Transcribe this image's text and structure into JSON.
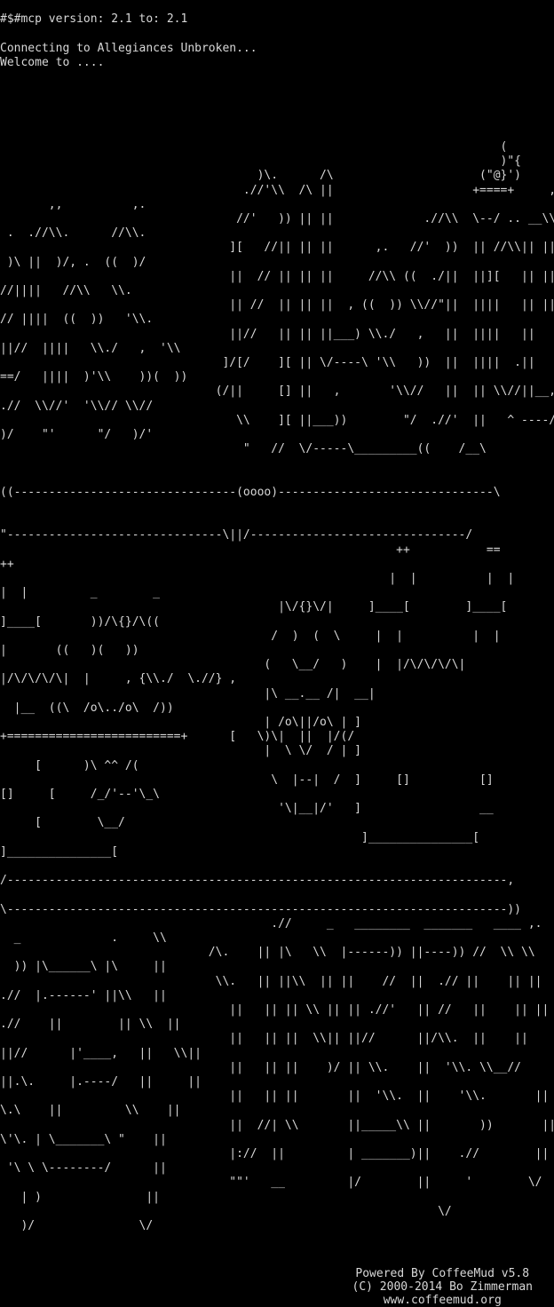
{
  "terminal": {
    "mcp_line": "#$#mcp version: 2.1 to: 2.1",
    "connecting": "Connecting to Allegiances Unbroken...",
    "welcome": "Welcome to ....",
    "art": [
      "                                                                        (",
      "                                                                        )\"{",
      "                                     )\\.      /\\                     (\"@}')",
      "                                   .//'\\\\  /\\ ||                    +====+     ,",
      "       ,,          ,.",
      "                                  //'   )) || ||             .//\\\\  \\--/ .. __\\\\.",
      " .  .//\\\\.      //\\\\.",
      "                                 ][   //|| || ||      ,.   //'  ))  || //\\\\|| ||",
      " )\\ ||  )/, .  ((  )/",
      "                                 ||  // || || ||     //\\\\ ((  ./||  ||][   || ||",
      "//||||   //\\\\   \\\\.",
      "                                 || //  || || ||  , ((  )) \\\\//\"||  ||||   || ||",
      "// ||||  ((  ))   '\\\\.",
      "                                 ||//   || || ||___) \\\\./   ,   ||  ||||   ||",
      "||//  ||||   \\\\./   ,  '\\\\",
      "                                ]/[/    ][ || \\/----\\ '\\\\   ))  ||  ||||  .||",
      "==/   ||||  )'\\\\    ))(  ))",
      "                               (/||     [] ||   ,       '\\\\//   ||  || \\\\//||__,",
      ".//  \\\\//'  '\\\\// \\\\//",
      "                                  \\\\    ][ ||___))        \"/  .//'  ||   ^ ----/",
      ")/    \"'      \"/   )/'",
      "                                   \"   //  \\/-----\\_________((    /__\\",
      "",
      "",
      "((--------------------------------(oooo)-------------------------------\\",
      "",
      "",
      "\"-------------------------------\\||/-------------------------------/",
      "                                                         ++           ==",
      "++",
      "                                                        |  |          |  |",
      "|  |         _        _",
      "                                        |\\/{}\\/|     ]____[        ]____[",
      "]____[       ))/\\{}/\\((",
      "                                       /  )  (  \\     |  |          |  |         |",
      "|       ((   )(   ))",
      "                                      (   \\__/   )    |  |/\\/\\/\\/\\|",
      "|/\\/\\/\\/\\|  |     , {\\\\./  \\.//} ,",
      "                                      |\\ __.__ /|  __|",
      "  |__  ((\\  /o\\../o\\  /))",
      "                                      | /o\\||/o\\ | ]",
      "+=========================+      [   \\)\\|  ||  |/(/",
      "                                      |  \\ \\/  / | ]",
      "     [      )\\ ^^ /(",
      "                                       \\  |--|  /  ]     []          []",
      "[]     [     /_/'--'\\_\\",
      "                                        '\\|__|/'   ]                 __",
      "     [        \\__/",
      "                                                    ]_______________[",
      "]_______________[",
      "",
      "/------------------------------------------------------------------------,",
      "",
      "\\------------------------------------------------------------------------))",
      "                                       .//     _   ________  _______   ____ ,.",
      "  _             .     \\\\",
      "                              /\\.    || |\\   \\\\  |------)) ||----)) //  \\\\ \\\\",
      "  )) |\\______\\ |\\     ||",
      "                               \\\\.   || ||\\\\  || ||    //  ||  .// ||    || ||",
      ".//  |.------' ||\\\\   ||",
      "                                 ||   || || \\\\ || || .//'   || //   ||    || ||",
      ".//    ||        || \\\\  ||",
      "                                 ||   || ||  \\\\|| ||//      ||/\\\\.  ||    ||",
      "||//      |'____,   ||   \\\\||",
      "                                 ||   || ||    )/ || \\\\.    ||  '\\\\. \\\\__//",
      "||.\\.     |.----/   ||     ||",
      "                                 ||   || ||       ||  '\\\\.  ||    '\\\\.       ||",
      "\\.\\    ||         \\\\    ||",
      "                                 ||  //| \\\\       ||_____\\\\ ||       ))       ||",
      "\\'\\. | \\_______\\ \"    ||",
      "                                 |://  ||         | _______)||    .//        ||",
      " '\\ \\ \\--------/      ||",
      "                                 \"\"'   __         |/        ||     '        \\/",
      "   | )               ||",
      "                                                               \\/",
      "   )/               \\/"
    ],
    "footer": [
      "Powered By CoffeeMud v5.8",
      "(C) 2000-2014 Bo Zimmerman",
      "www.coffeemud.org"
    ]
  }
}
